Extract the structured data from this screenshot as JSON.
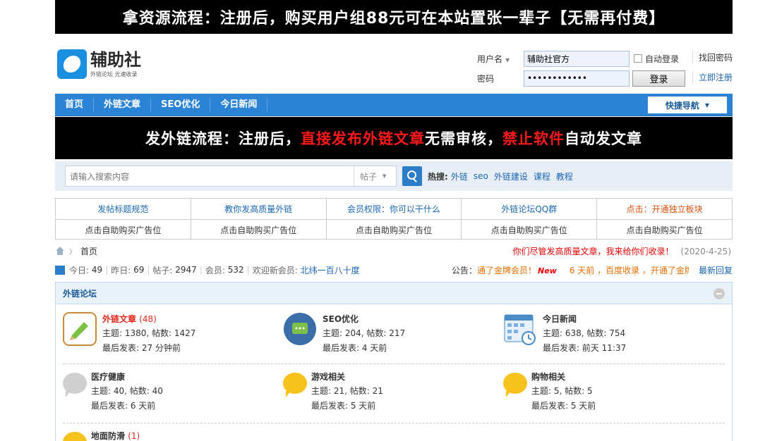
{
  "top_banner": "拿资源流程：注册后，购买用户组88元可在本站置张一辈子【无需再付费】",
  "logo": {
    "name": "辅助社",
    "sub": "外链论坛 光速收录"
  },
  "login": {
    "username_label": "用户名",
    "username_value": "辅助社官方",
    "password_label": "密码",
    "password_value": "••••••••••••",
    "remember": "自动登录",
    "submit": "登录",
    "forgot": "找回密码",
    "register": "立即注册"
  },
  "nav": {
    "items": [
      "首页",
      "外链文章",
      "SEO优化",
      "今日新闻"
    ],
    "quick": "快捷导航"
  },
  "mid_banner": {
    "p1": "发外链流程：注册后，",
    "p2": "直接发布外链文章",
    "p3": "无需审核，",
    "p4": "禁止软件",
    "p5": "自动发文章"
  },
  "search": {
    "placeholder": "请输入搜索内容",
    "type": "帖子",
    "hot_label": "热搜:",
    "hot": [
      "外链",
      "seo",
      "外链建设",
      "课程",
      "教程"
    ]
  },
  "grid": {
    "row1": [
      "发帖标题规范",
      "教你发高质量外链",
      "会员权限：你可以干什么",
      "外链论坛QQ群",
      "点击：开通独立板块"
    ],
    "row2": [
      "点击自助购买广告位",
      "点击自助购买广告位",
      "点击自助购买广告位",
      "点击自助购买广告位",
      "点击自助购买广告位"
    ]
  },
  "crumb": {
    "home": "首页",
    "notice": "你们尽管发高质量文章，我来给你们收录！",
    "date": "(2020-4-25)"
  },
  "stats": {
    "today_l": "今日:",
    "today": "49",
    "yest_l": "昨日:",
    "yest": "69",
    "posts_l": "帖子:",
    "posts": "2947",
    "members_l": "会员:",
    "members": "532",
    "welcome": "欢迎新会员:",
    "newest": "北纬一百八十度"
  },
  "announce": {
    "label": "公告：",
    "t1": "通了金牌会员！",
    "new": "New",
    "t2": "6 天前 ，百度收录 ，开通了金牌",
    "latest": "最新回复"
  },
  "forum": {
    "title": "外链论坛",
    "items": [
      {
        "name": "外链文章",
        "count": "(48)",
        "topics": "主题: 1380, 帖数: 1427",
        "last": "最后发表: 27 分钟前"
      },
      {
        "name": "SEO优化",
        "topics": "主题: 204, 帖数: 217",
        "last": "最后发表: 4 天前"
      },
      {
        "name": "今日新闻",
        "topics": "主题: 638, 帖数: 754",
        "last": "最后发表: 前天 11:37"
      },
      {
        "name": "医疗健康",
        "topics": "主题: 40, 帖数: 40",
        "last": "最后发表: 6 天前"
      },
      {
        "name": "游戏相关",
        "topics": "主题: 21, 帖数: 21",
        "last": "最后发表: 5 天前"
      },
      {
        "name": "购物相关",
        "topics": "主题: 5, 帖数: 5",
        "last": "最后发表: 5 天前"
      },
      {
        "name": "地面防滑",
        "count": "(1)"
      }
    ]
  }
}
